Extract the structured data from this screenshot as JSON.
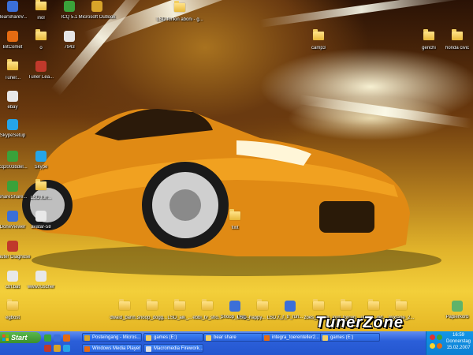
{
  "desktop": {
    "brand_logo_text": "TunerZone",
    "icons": [
      {
        "label": "BearShareV...",
        "kind": "app",
        "color": "#3b6fd8"
      },
      {
        "label": "inol",
        "kind": "folder"
      },
      {
        "label": "ICQ 5.1",
        "kind": "app",
        "color": "#3aa23a"
      },
      {
        "label": "Microsoft Outlook",
        "kind": "app",
        "color": "#d8a42a"
      },
      {
        "label": "LSD funkin aboni - g...",
        "kind": "folder"
      },
      {
        "label": "BitComet",
        "kind": "app",
        "color": "#e56b12"
      },
      {
        "label": "o",
        "kind": "folder"
      },
      {
        "label": "7943",
        "kind": "app",
        "color": "#e6e6e6"
      },
      {
        "label": "camp3",
        "kind": "folder"
      },
      {
        "label": "genchi",
        "kind": "folder"
      },
      {
        "label": "honda civic",
        "kind": "folder"
      },
      {
        "label": "Tuner...",
        "kind": "folder"
      },
      {
        "label": "Tuner Lea...",
        "kind": "app",
        "color": "#c0392b"
      },
      {
        "label": "ebay",
        "kind": "app",
        "color": "#e8e8e8"
      },
      {
        "label": "SkypeSetup",
        "kind": "app",
        "color": "#25a5e8"
      },
      {
        "label": "icq2003bdel...",
        "kind": "app",
        "color": "#3aa23a"
      },
      {
        "label": "Skype",
        "kind": "app",
        "color": "#25a5e8"
      },
      {
        "label": "ShareShare...",
        "kind": "app",
        "color": "#3aa23a"
      },
      {
        "label": "LSD.fun...",
        "kind": "folder"
      },
      {
        "label": "DoneViewer",
        "kind": "app",
        "color": "#3b6fd8"
      },
      {
        "label": "avatar-58",
        "kind": "app",
        "color": "#e8e8e8"
      },
      {
        "label": "fixit",
        "kind": "folder"
      },
      {
        "label": "Router Diagnose",
        "kind": "app",
        "color": "#c0392b"
      },
      {
        "label": "ctrl.bat",
        "kind": "app",
        "color": "#e8e8e8"
      },
      {
        "label": "www.ruscher",
        "kind": "app",
        "color": "#e8e8e8"
      },
      {
        "label": "egbost",
        "kind": "folder"
      },
      {
        "label": "dwaid_bann...",
        "kind": "folder"
      },
      {
        "label": "snoop_dogg...",
        "kind": "folder"
      },
      {
        "label": "LSD_aik_...",
        "kind": "folder"
      },
      {
        "label": "ebbi_tv_sho...",
        "kind": "folder"
      },
      {
        "label": "Snoop_Dog...",
        "kind": "app",
        "color": "#3b6fd8"
      },
      {
        "label": "LSD_happy... LSD...mdam",
        "kind": "folder"
      },
      {
        "label": "7_r_tr_run...",
        "kind": "app",
        "color": "#3b6fd8"
      },
      {
        "label": "zoes_kl_am...",
        "kind": "folder"
      },
      {
        "label": "lord_forcyn...",
        "kind": "folder"
      },
      {
        "label": "ukraat_did...",
        "kind": "folder"
      },
      {
        "label": "mixtape_2...",
        "kind": "folder"
      },
      {
        "label": "Papierkorb",
        "kind": "app",
        "color": "#5fb36a"
      }
    ]
  },
  "taskbar": {
    "start_label": "Start",
    "row1": [
      {
        "label": "Posteingang - Micros...",
        "color": "#d8a42a"
      },
      {
        "label": "games (E:)",
        "color": "#f2cf62"
      },
      {
        "label": "bear share",
        "color": "#f2cf62"
      },
      {
        "label": "integra_toerenteller2...",
        "color": "#e56b12"
      },
      {
        "label": "games (E:)",
        "color": "#f2cf62"
      }
    ],
    "row2": [
      {
        "label": "Windows Media Player",
        "color": "#e56b12"
      },
      {
        "label": "Macromedia Firework...",
        "color": "#e0e0e0"
      }
    ],
    "clock": {
      "time": "16:59",
      "day": "Donnerstag",
      "date": "15.02.2007"
    }
  }
}
